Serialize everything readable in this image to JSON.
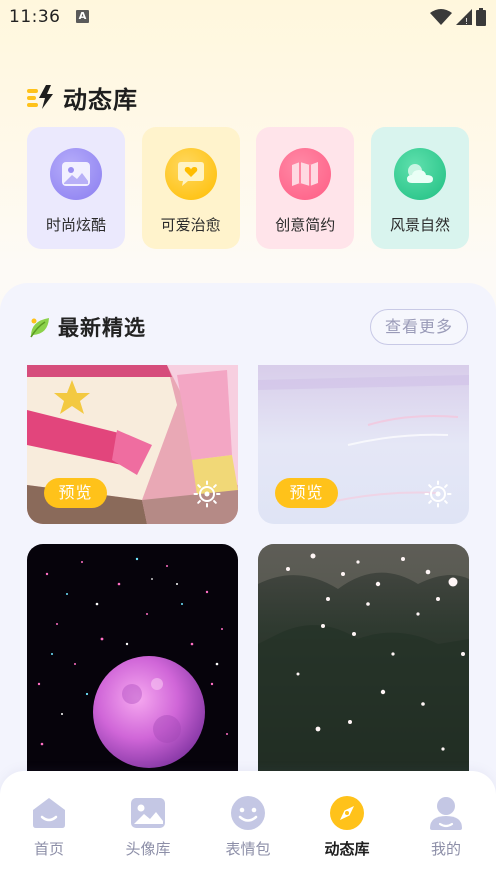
{
  "status_bar": {
    "time": "11:36",
    "notification_letter": "A"
  },
  "header": {
    "title": "动态库",
    "icon": "lightning-icon"
  },
  "categories": [
    {
      "label": "时尚炫酷",
      "icon": "image-icon",
      "bg": "#ebe9fd",
      "icon_color": "#9b8ff2"
    },
    {
      "label": "可爱治愈",
      "icon": "heart-chat-icon",
      "bg": "#fff3cc",
      "icon_color": "#ffc412"
    },
    {
      "label": "创意简约",
      "icon": "map-icon",
      "bg": "#ffe4ea",
      "icon_color": "#ff6b8e"
    },
    {
      "label": "风景自然",
      "icon": "cloud-sun-icon",
      "bg": "#d9f4ee",
      "icon_color": "#2bcf8f"
    }
  ],
  "section": {
    "title": "最新精选",
    "icon": "leaf-icon",
    "more_label": "查看更多"
  },
  "wallpapers": [
    {
      "name": "anime-card-wallpaper",
      "badge": "预览",
      "has_badge": true
    },
    {
      "name": "pastel-sky-wallpaper",
      "badge": "预览",
      "has_badge": true
    },
    {
      "name": "pink-moon-galaxy-wallpaper",
      "has_badge": false
    },
    {
      "name": "falling-petals-forest-wallpaper",
      "has_badge": false
    }
  ],
  "bottom_nav": [
    {
      "label": "首页",
      "icon": "home-icon",
      "active": false
    },
    {
      "label": "头像库",
      "icon": "image-icon",
      "active": false
    },
    {
      "label": "表情包",
      "icon": "smile-icon",
      "active": false
    },
    {
      "label": "动态库",
      "icon": "compass-icon",
      "active": true
    },
    {
      "label": "我的",
      "icon": "user-icon",
      "active": false
    }
  ],
  "colors": {
    "accent": "#ffc21a",
    "inactive_nav": "#c4c7e4",
    "inactive_label": "#8d8fa8",
    "panel_bg": "#f3f4fd"
  }
}
